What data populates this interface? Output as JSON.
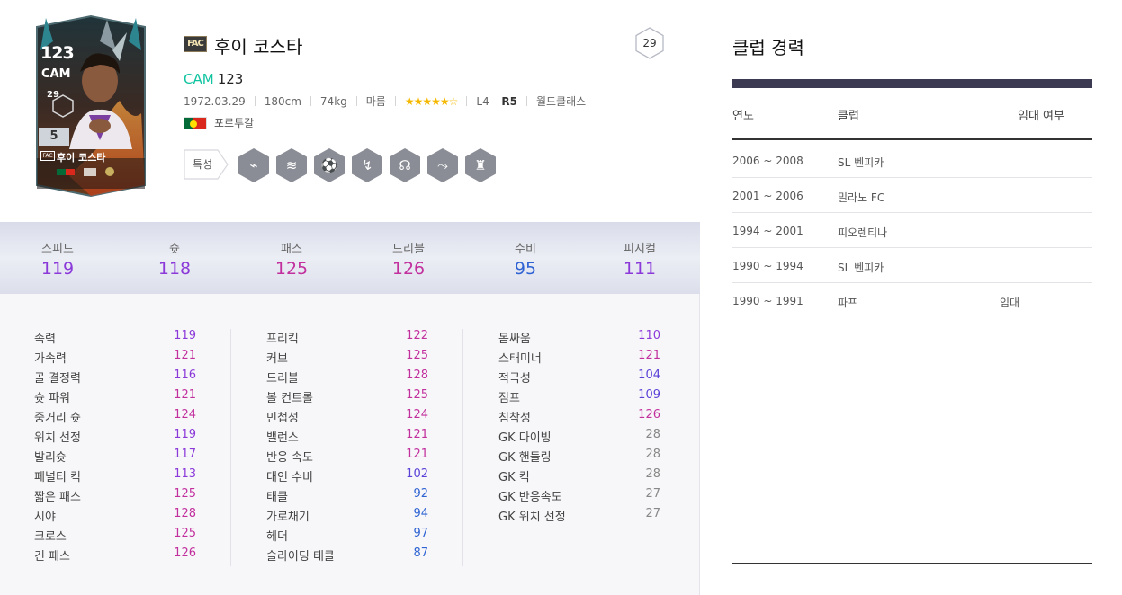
{
  "player": {
    "season_logo": "FAC",
    "name": "후이 코스타",
    "season_num": "29",
    "position": "CAM",
    "ovr": "123",
    "birth": "1972.03.29",
    "height": "180cm",
    "weight": "74kg",
    "body": "마름",
    "skill_stars": "★★★★★☆",
    "weak_foot_prefix": "L4 – ",
    "weak_foot_strong": "R5",
    "reputation": "월드클래스",
    "nation": "포르투갈",
    "trait_label": "특성",
    "trait_icons": [
      "trait-longshot-icon",
      "trait-speed-icon",
      "trait-ball-icon",
      "trait-flair-icon",
      "trait-playmaker-icon",
      "trait-dribble-icon",
      "trait-player-icon"
    ]
  },
  "card": {
    "ovr": "123",
    "position": "CAM",
    "badge": "29",
    "grade": "5",
    "logo": "FAC",
    "name": "후이 코스타"
  },
  "summary": [
    {
      "label": "스피드",
      "value": "119",
      "color": "#8b3ad9"
    },
    {
      "label": "슛",
      "value": "118",
      "color": "#8b3ad9"
    },
    {
      "label": "패스",
      "value": "125",
      "color": "#c2309e"
    },
    {
      "label": "드리블",
      "value": "126",
      "color": "#c2309e"
    },
    {
      "label": "수비",
      "value": "95",
      "color": "#2f63d3"
    },
    {
      "label": "피지컬",
      "value": "111",
      "color": "#8b3ad9"
    }
  ],
  "detail": [
    [
      {
        "name": "속력",
        "value": "119",
        "cls": "c-purple"
      },
      {
        "name": "가속력",
        "value": "121",
        "cls": "c-magenta"
      },
      {
        "name": "골 결정력",
        "value": "116",
        "cls": "c-purple"
      },
      {
        "name": "슛 파워",
        "value": "121",
        "cls": "c-magenta"
      },
      {
        "name": "중거리 슛",
        "value": "124",
        "cls": "c-magenta"
      },
      {
        "name": "위치 선정",
        "value": "119",
        "cls": "c-purple"
      },
      {
        "name": "발리슛",
        "value": "117",
        "cls": "c-purple"
      },
      {
        "name": "페널티 킥",
        "value": "113",
        "cls": "c-purple"
      },
      {
        "name": "짧은 패스",
        "value": "125",
        "cls": "c-magenta"
      },
      {
        "name": "시야",
        "value": "128",
        "cls": "c-magenta"
      },
      {
        "name": "크로스",
        "value": "125",
        "cls": "c-magenta"
      },
      {
        "name": "긴 패스",
        "value": "126",
        "cls": "c-magenta"
      }
    ],
    [
      {
        "name": "프리킥",
        "value": "122",
        "cls": "c-magenta"
      },
      {
        "name": "커브",
        "value": "125",
        "cls": "c-magenta"
      },
      {
        "name": "드리블",
        "value": "128",
        "cls": "c-magenta"
      },
      {
        "name": "볼 컨트롤",
        "value": "125",
        "cls": "c-magenta"
      },
      {
        "name": "민첩성",
        "value": "124",
        "cls": "c-magenta"
      },
      {
        "name": "밸런스",
        "value": "121",
        "cls": "c-magenta"
      },
      {
        "name": "반응 속도",
        "value": "121",
        "cls": "c-magenta"
      },
      {
        "name": "대인 수비",
        "value": "102",
        "cls": "c-indigo"
      },
      {
        "name": "태클",
        "value": "92",
        "cls": "c-blue"
      },
      {
        "name": "가로채기",
        "value": "94",
        "cls": "c-blue"
      },
      {
        "name": "헤더",
        "value": "97",
        "cls": "c-blue"
      },
      {
        "name": "슬라이딩 태클",
        "value": "87",
        "cls": "c-blue"
      }
    ],
    [
      {
        "name": "몸싸움",
        "value": "110",
        "cls": "c-purple"
      },
      {
        "name": "스태미너",
        "value": "121",
        "cls": "c-magenta"
      },
      {
        "name": "적극성",
        "value": "104",
        "cls": "c-indigo"
      },
      {
        "name": "점프",
        "value": "109",
        "cls": "c-indigo"
      },
      {
        "name": "침착성",
        "value": "126",
        "cls": "c-magenta"
      },
      {
        "name": "GK 다이빙",
        "value": "28",
        "cls": "c-gray"
      },
      {
        "name": "GK 핸들링",
        "value": "28",
        "cls": "c-gray"
      },
      {
        "name": "GK 킥",
        "value": "28",
        "cls": "c-gray"
      },
      {
        "name": "GK 반응속도",
        "value": "27",
        "cls": "c-gray"
      },
      {
        "name": "GK 위치 선정",
        "value": "27",
        "cls": "c-gray"
      }
    ]
  ],
  "clubs": {
    "title": "클럽 경력",
    "headers": {
      "year": "연도",
      "club": "클럽",
      "loan": "임대 여부"
    },
    "rows": [
      {
        "year": "2006 ~ 2008",
        "club": "SL 벤피카",
        "loan": ""
      },
      {
        "year": "2001 ~ 2006",
        "club": "밀라노 FC",
        "loan": ""
      },
      {
        "year": "1994 ~ 2001",
        "club": "피오렌티나",
        "loan": ""
      },
      {
        "year": "1990 ~ 1994",
        "club": "SL 벤피카",
        "loan": ""
      },
      {
        "year": "1990 ~ 1991",
        "club": "파프",
        "loan": "임대"
      }
    ]
  }
}
